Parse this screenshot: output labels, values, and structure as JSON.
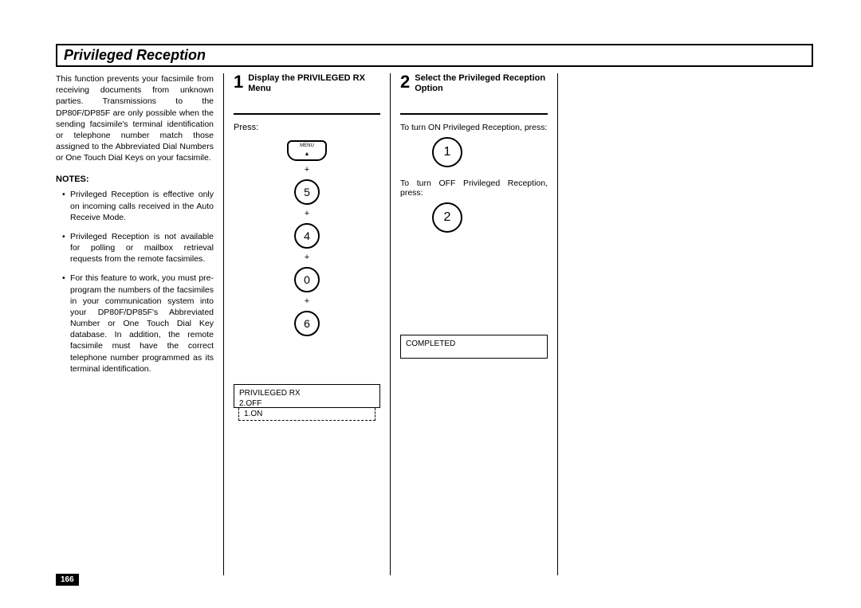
{
  "title": "Privileged Reception",
  "intro": "This function prevents your facsimile from receiving documents from unknown parties. Transmissions to the DP80F/DP85F are only possible when the sending facsimile's terminal identification or telephone number match those assigned to the Abbreviated Dial Numbers or One Touch Dial Keys on your facsimile.",
  "notes_heading": "NOTES:",
  "notes": [
    "Privileged Reception is effective only on incoming calls received in the Auto Receive Mode.",
    "Privileged Reception is not available for polling or mailbox retrieval requests from the remote facsimiles.",
    "For this feature to work, you must pre-program the numbers of the facsimiles in your communication system into your DP80F/DP85F's Abbreviated Number or One Touch Dial Key database. In addition, the remote facsimile must have the correct telephone number programmed as its terminal identification."
  ],
  "step1": {
    "num": "1",
    "title": "Display the PRIVILEGED RX Menu",
    "press": "Press:",
    "menu_label": "MENU",
    "keys": [
      "5",
      "4",
      "0",
      "6"
    ],
    "plus": "+",
    "display_line1": "PRIVILEGED RX",
    "display_line2": "2.OFF",
    "display_sub": "1.ON"
  },
  "step2": {
    "num": "2",
    "title": "Select the Privileged Reception Option",
    "on_text": "To turn ON Privileged Reception, press:",
    "on_key": "1",
    "off_text": "To turn OFF Privileged Reception, press:",
    "off_key": "2",
    "display_line1": "COMPLETED"
  },
  "page_number": "166"
}
